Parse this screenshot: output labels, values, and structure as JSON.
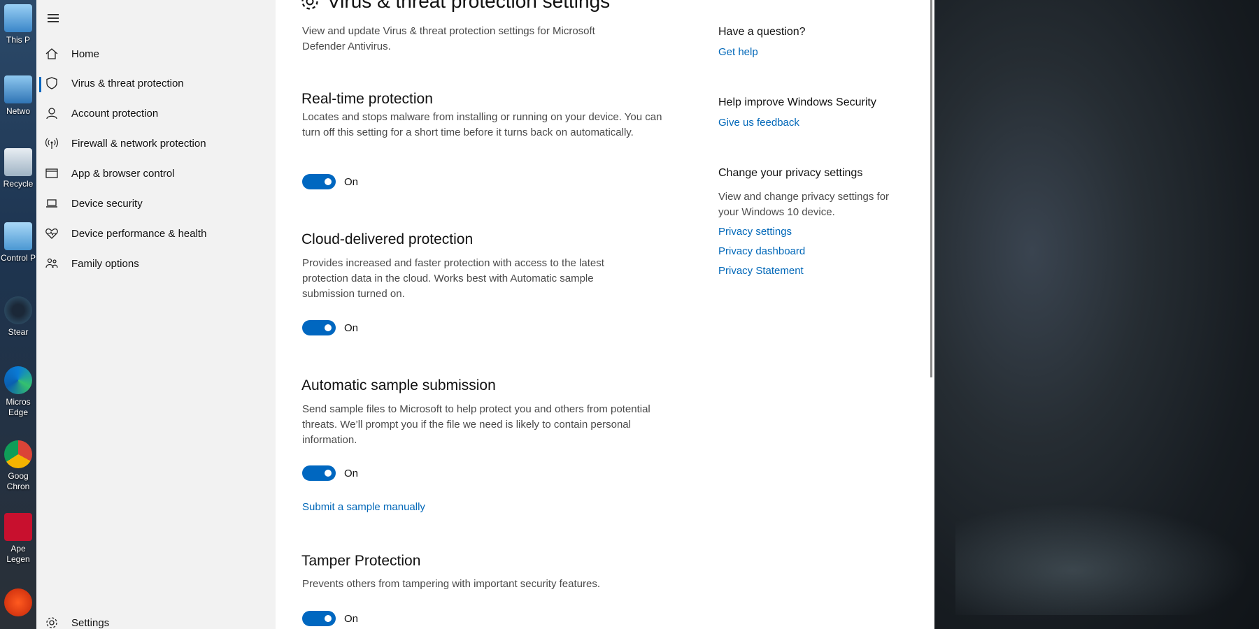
{
  "desktop": {
    "icons": [
      {
        "name": "this-pc",
        "label": "This P"
      },
      {
        "name": "network",
        "label": "Netwo"
      },
      {
        "name": "recycle-bin",
        "label": "Recycle"
      },
      {
        "name": "control-panel",
        "label": "Control P"
      },
      {
        "name": "steam",
        "label": "Stear"
      },
      {
        "name": "microsoft-edge",
        "label": "Micros\nEdge"
      },
      {
        "name": "google-chrome",
        "label": "Goog\nChron"
      },
      {
        "name": "apex-legends",
        "label": "Ape\nLegen"
      },
      {
        "name": "ea",
        "label": ""
      }
    ]
  },
  "nav": {
    "items": [
      {
        "label": "Home",
        "icon": "home-icon"
      },
      {
        "label": "Virus & threat protection",
        "icon": "shield-icon",
        "selected": true
      },
      {
        "label": "Account protection",
        "icon": "person-icon"
      },
      {
        "label": "Firewall & network protection",
        "icon": "antenna-icon"
      },
      {
        "label": "App & browser control",
        "icon": "browser-window-icon"
      },
      {
        "label": "Device security",
        "icon": "laptop-icon"
      },
      {
        "label": "Device performance & health",
        "icon": "heart-pulse-icon"
      },
      {
        "label": "Family options",
        "icon": "family-icon"
      }
    ],
    "settings_label": "Settings"
  },
  "main": {
    "title": "Virus & threat protection settings",
    "description": "View and update Virus & threat protection settings for Microsoft Defender Antivirus.",
    "sections": [
      {
        "title": "Real-time protection",
        "description": "Locates and stops malware from installing or running on your device. You can turn off this setting for a short time before it turns back on automatically.",
        "toggle": "On"
      },
      {
        "title": "Cloud-delivered protection",
        "description": "Provides increased and faster protection with access to the latest protection data in the cloud. Works best with Automatic sample submission turned on.",
        "toggle": "On"
      },
      {
        "title": "Automatic sample submission",
        "description": "Send sample files to Microsoft to help protect you and others from potential threats. We’ll prompt you if the file we need is likely to contain personal information.",
        "toggle": "On",
        "link": "Submit a sample manually"
      },
      {
        "title": "Tamper Protection",
        "description": "Prevents others from tampering with important security features.",
        "toggle": "On"
      }
    ]
  },
  "side": {
    "question_head": "Have a question?",
    "get_help": "Get help",
    "improve_head": "Help improve Windows Security",
    "feedback": "Give us feedback",
    "privacy_head": "Change your privacy settings",
    "privacy_desc": "View and change privacy settings for your Windows 10 device.",
    "privacy_settings": "Privacy settings",
    "privacy_dashboard": "Privacy dashboard",
    "privacy_statement": "Privacy Statement"
  },
  "colors": {
    "accent": "#0067c0",
    "link": "#0067b8"
  }
}
